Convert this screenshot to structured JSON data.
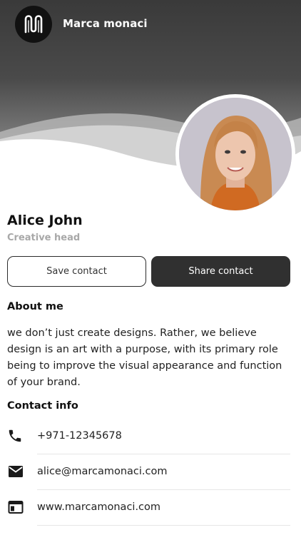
{
  "header": {
    "brand_name": "Marca monaci",
    "logo_icon": "script-m-logo-icon"
  },
  "profile": {
    "name": "Alice John",
    "title": "Creative head",
    "avatar": "profile-photo"
  },
  "actions": {
    "save_label": "Save contact",
    "share_label": "Share contact"
  },
  "about": {
    "heading": "About me",
    "text": "we don’t just create designs. Rather, we believe design is an art with a purpose, with its primary role being to improve the visual appearance and function of your brand."
  },
  "contact": {
    "heading": "Contact info",
    "items": [
      {
        "icon": "phone-icon",
        "value": "+971-12345678"
      },
      {
        "icon": "email-icon",
        "value": "alice@marcamonaci.com"
      },
      {
        "icon": "web-icon",
        "value": "www.marcamonaci.com"
      }
    ]
  },
  "colors": {
    "dark": "#303030",
    "muted": "#a8a8a8",
    "header_top": "#3a3a3a"
  }
}
